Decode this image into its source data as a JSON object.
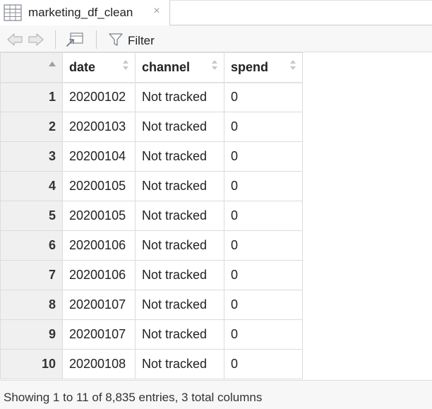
{
  "tab": {
    "title": "marketing_df_clean",
    "close_glyph": "×",
    "icon": "table-icon"
  },
  "toolbar": {
    "back_icon": "back-arrow-icon",
    "forward_icon": "forward-arrow-icon",
    "popout_icon": "popout-window-icon",
    "filter_icon": "filter-funnel-icon",
    "filter_label": "Filter"
  },
  "table": {
    "columns": [
      "date",
      "channel",
      "spend"
    ],
    "rows": [
      {
        "num": "1",
        "date": "20200102",
        "channel": "Not tracked",
        "spend": "0"
      },
      {
        "num": "2",
        "date": "20200103",
        "channel": "Not tracked",
        "spend": "0"
      },
      {
        "num": "3",
        "date": "20200104",
        "channel": "Not tracked",
        "spend": "0"
      },
      {
        "num": "4",
        "date": "20200105",
        "channel": "Not tracked",
        "spend": "0"
      },
      {
        "num": "5",
        "date": "20200105",
        "channel": "Not tracked",
        "spend": "0"
      },
      {
        "num": "6",
        "date": "20200106",
        "channel": "Not tracked",
        "spend": "0"
      },
      {
        "num": "7",
        "date": "20200106",
        "channel": "Not tracked",
        "spend": "0"
      },
      {
        "num": "8",
        "date": "20200107",
        "channel": "Not tracked",
        "spend": "0"
      },
      {
        "num": "9",
        "date": "20200107",
        "channel": "Not tracked",
        "spend": "0"
      },
      {
        "num": "10",
        "date": "20200108",
        "channel": "Not tracked",
        "spend": "0"
      }
    ]
  },
  "status": {
    "text": "Showing 1 to 11 of 8,835 entries, 3 total columns"
  }
}
